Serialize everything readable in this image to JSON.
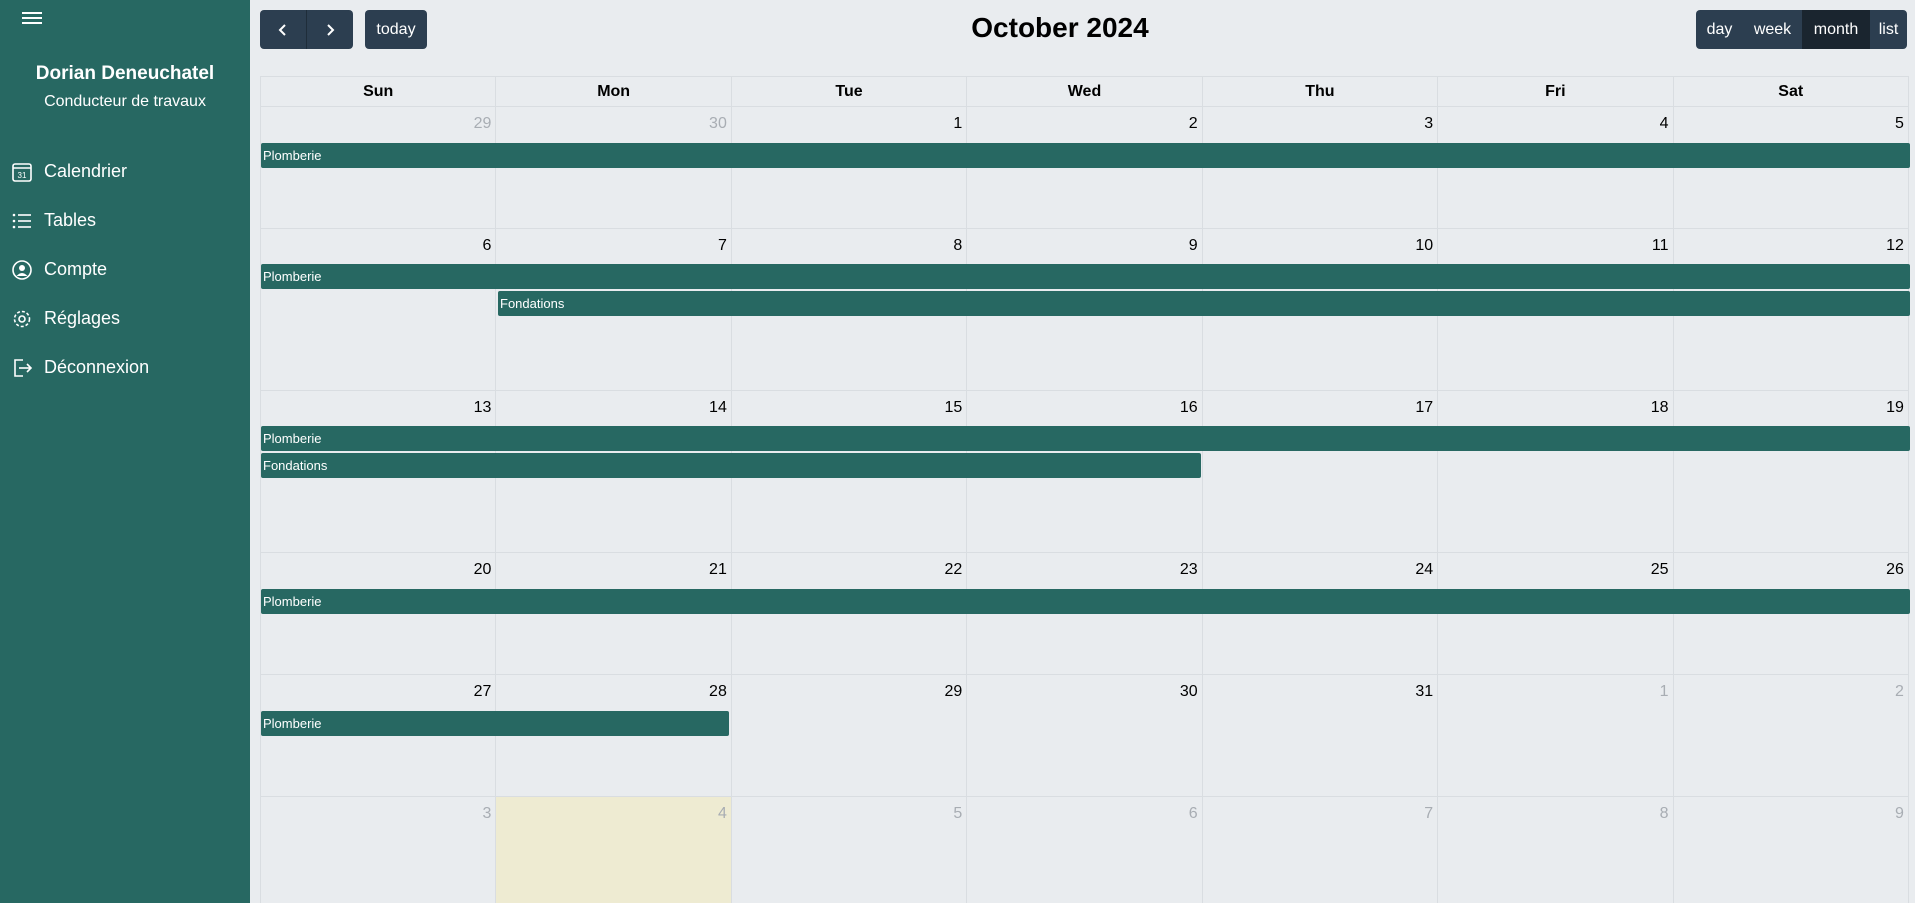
{
  "user": {
    "name": "Dorian Deneuchatel",
    "role": "Conducteur de travaux"
  },
  "sidebar": {
    "items": [
      {
        "label": "Calendrier",
        "icon": "calendar-icon"
      },
      {
        "label": "Tables",
        "icon": "list-icon"
      },
      {
        "label": "Compte",
        "icon": "account-icon"
      },
      {
        "label": "Réglages",
        "icon": "gear-icon"
      },
      {
        "label": "Déconnexion",
        "icon": "logout-icon"
      }
    ]
  },
  "toolbar": {
    "today_label": "today",
    "title": "October 2024",
    "views": [
      "day",
      "week",
      "month",
      "list"
    ],
    "active_view": "month"
  },
  "calendar": {
    "weekdays": [
      "Sun",
      "Mon",
      "Tue",
      "Wed",
      "Thu",
      "Fri",
      "Sat"
    ],
    "weeks": [
      {
        "days": [
          "29",
          "30",
          "1",
          "2",
          "3",
          "4",
          "5"
        ]
      },
      {
        "days": [
          "6",
          "7",
          "8",
          "9",
          "10",
          "11",
          "12"
        ]
      },
      {
        "days": [
          "13",
          "14",
          "15",
          "16",
          "17",
          "18",
          "19"
        ]
      },
      {
        "days": [
          "20",
          "21",
          "22",
          "23",
          "24",
          "25",
          "26"
        ]
      },
      {
        "days": [
          "27",
          "28",
          "29",
          "30",
          "31",
          "1",
          "2"
        ]
      },
      {
        "days": [
          "3",
          "4",
          "5",
          "6",
          "7",
          "8",
          "9"
        ]
      }
    ],
    "events": [
      {
        "title": "Plomberie"
      },
      {
        "title": "Fondations"
      }
    ]
  },
  "colors": {
    "sidebar": "#276862",
    "event": "#276862",
    "button": "#2c3e50",
    "today_highlight": "#eeebd2"
  }
}
